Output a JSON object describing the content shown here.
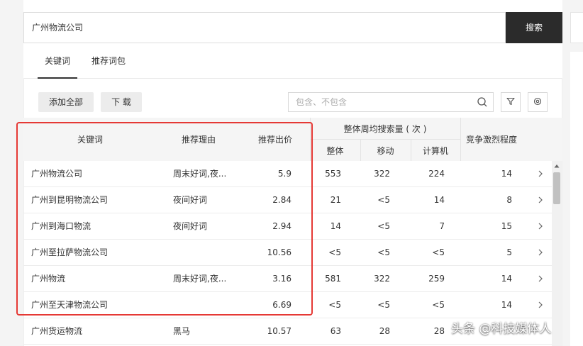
{
  "search": {
    "value": "广州物流公司",
    "button_label": "搜索"
  },
  "tabs": [
    {
      "label": "关键词",
      "active": true
    },
    {
      "label": "推荐词包",
      "active": false
    }
  ],
  "toolbar": {
    "add_all_label": "添加全部",
    "download_label": "下 载",
    "filter_placeholder": "包含、不包含",
    "icons": [
      "search-icon",
      "filter-icon",
      "settings-icon"
    ]
  },
  "table": {
    "headers": {
      "keyword": "关键词",
      "reason": "推荐理由",
      "bid": "推荐出价",
      "weekly_group": "整体周均搜索量 ( 次 )",
      "overall": "整体",
      "mobile": "移动",
      "pc": "计算机",
      "competition": "竞争激烈程度"
    },
    "rows": [
      {
        "keyword": "广州物流公司",
        "reason": "周末好词,夜...",
        "bid": "5.9",
        "overall": "553",
        "mobile": "322",
        "pc": "224",
        "competition": "14"
      },
      {
        "keyword": "广州到昆明物流公司",
        "reason": "夜间好词",
        "bid": "2.84",
        "overall": "21",
        "mobile": "<5",
        "pc": "14",
        "competition": "8"
      },
      {
        "keyword": "广州到海口物流",
        "reason": "夜间好词",
        "bid": "2.94",
        "overall": "14",
        "mobile": "<5",
        "pc": "7",
        "competition": "15"
      },
      {
        "keyword": "广州至拉萨物流公司",
        "reason": "",
        "bid": "10.56",
        "overall": "<5",
        "mobile": "<5",
        "pc": "<5",
        "competition": "5"
      },
      {
        "keyword": "广州物流",
        "reason": "周末好词,夜...",
        "bid": "3.16",
        "overall": "581",
        "mobile": "322",
        "pc": "259",
        "competition": "14"
      },
      {
        "keyword": "广州至天津物流公司",
        "reason": "",
        "bid": "6.69",
        "overall": "<5",
        "mobile": "<5",
        "pc": "<5",
        "competition": "14"
      },
      {
        "keyword": "广州货运物流",
        "reason": "黑马",
        "bid": "10.57",
        "overall": "63",
        "mobile": "28",
        "pc": "28",
        "competition": ""
      }
    ]
  },
  "watermark": "头条 @科技媒体人",
  "colors": {
    "search_button": "#2b2b2b",
    "highlight": "#e53935",
    "header_bg": "#f5f5f5"
  }
}
